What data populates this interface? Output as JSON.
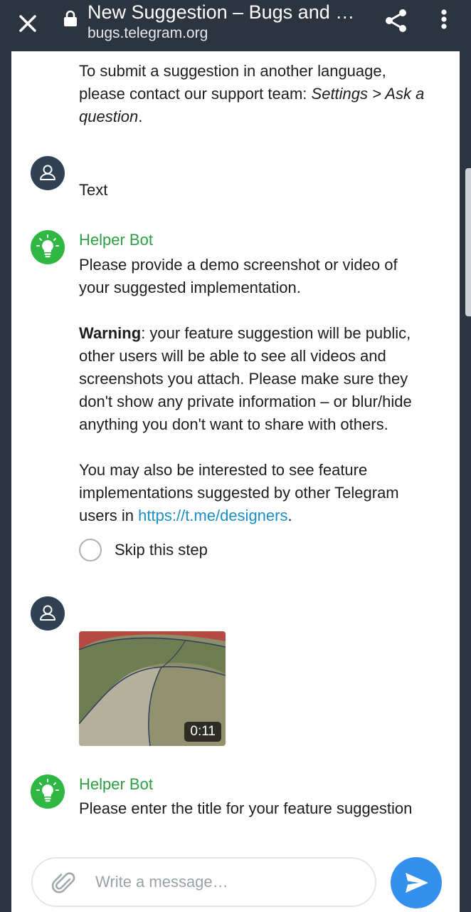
{
  "browser": {
    "title": "New Suggestion – Bugs and …",
    "url": "bugs.telegram.org"
  },
  "messages": {
    "intro": {
      "line1": "To submit a suggestion in another language,",
      "line2_prefix": "please contact our support team: ",
      "line2_italic": "Settings > Ask a",
      "line3_italic": "question",
      "line3_suffix": "."
    },
    "user_reply_1": "Text",
    "bot_1": {
      "name": "Helper Bot",
      "p1_line1": "Please provide a demo screenshot or video of",
      "p1_line2": "your suggested implementation.",
      "warning_bold": "Warning",
      "warning_line1": ": your feature suggestion will be public,",
      "warning_line2": "other users will be able to see all videos and",
      "warning_line3": "screenshots you attach. Please make sure they",
      "warning_line4": "don't show any private information – or blur/hide",
      "warning_line5": "anything you don't want to share with others.",
      "p3_line1": "You may also be interested to see feature",
      "p3_line2": "implementations suggested by other Telegram",
      "p3_line3_prefix": "users in ",
      "p3_link": "https://t.me/designers",
      "p3_line3_suffix": ".",
      "skip_label": "Skip this step"
    },
    "user_video": {
      "duration": "0:11"
    },
    "bot_2": {
      "name": "Helper Bot",
      "text": "Please enter the title for your feature suggestion"
    }
  },
  "composer": {
    "placeholder": "Write a message…"
  },
  "colors": {
    "bar": "#2c3440",
    "bot_green": "#2eb742",
    "bot_name": "#2da043",
    "user_avatar": "#2f4153",
    "link": "#1d8fc6",
    "send": "#3390ec"
  }
}
